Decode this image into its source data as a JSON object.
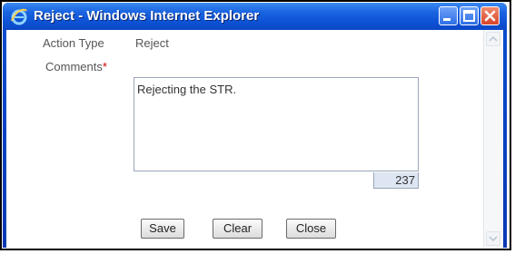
{
  "window": {
    "title": "Reject - Windows Internet Explorer"
  },
  "form": {
    "action_type_label": "Action Type",
    "action_type_value": "Reject",
    "comments_label": "Comments",
    "required_marker": "*",
    "comments_value": "Rejecting the STR.",
    "char_counter": "237"
  },
  "buttons": {
    "save": "Save",
    "clear": "Clear",
    "close": "Close"
  },
  "icons": {
    "app": "internet-explorer-icon",
    "minimize": "minimize-icon",
    "maximize": "maximize-icon",
    "close": "close-icon",
    "scroll_up": "scroll-up-arrow-icon",
    "scroll_down": "scroll-down-arrow-icon"
  }
}
